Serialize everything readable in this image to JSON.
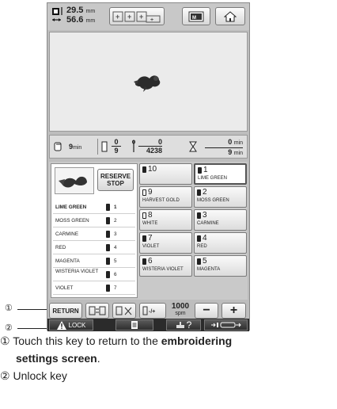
{
  "topbar": {
    "width": "29.5",
    "height": "56.6",
    "unit": "mm",
    "icons": [
      "size-icon",
      "move-pattern-icon",
      "memory-icon",
      "home-icon"
    ]
  },
  "status": {
    "remaining_time": "9",
    "remaining_time_unit": "min",
    "color_current": "0",
    "color_total": "9",
    "stitch_current": "0",
    "stitch_total": "4238",
    "time_elapsed": "0",
    "time_total": "9",
    "time_unit": "min"
  },
  "reserve_stop": "RESERVE STOP",
  "thread_list": [
    {
      "name": "LIME GREEN",
      "no": "1"
    },
    {
      "name": "MOSS GREEN",
      "no": "2"
    },
    {
      "name": "CARMINE",
      "no": "3"
    },
    {
      "name": "RED",
      "no": "4"
    },
    {
      "name": "MAGENTA",
      "no": "5"
    },
    {
      "name": "WISTERIA VIOLET",
      "no": "6"
    },
    {
      "name": "VIOLET",
      "no": "7"
    }
  ],
  "needles": [
    {
      "no": "10",
      "name": ""
    },
    {
      "no": "1",
      "name": "LIME GREEN"
    },
    {
      "no": "9",
      "name": "HARVEST GOLD"
    },
    {
      "no": "2",
      "name": "MOSS GREEN"
    },
    {
      "no": "8",
      "name": "WHITE"
    },
    {
      "no": "3",
      "name": "CARMINE"
    },
    {
      "no": "7",
      "name": "VIOLET"
    },
    {
      "no": "4",
      "name": "RED"
    },
    {
      "no": "6",
      "name": "WISTERIA VIOLET"
    },
    {
      "no": "5",
      "name": "MAGENTA"
    }
  ],
  "bottom": {
    "return_label": "RETURN",
    "speed": "1000",
    "speed_unit": "spm",
    "minus": "−",
    "plus": "+"
  },
  "lockbar": {
    "lock_label": "LOCK",
    "help": "?"
  },
  "callouts": {
    "one": "①",
    "two": "②"
  },
  "notes": {
    "note1_prefix": "Touch this key to return to the ",
    "note1_bold": "embroidering",
    "note1_bold2": "settings screen",
    "note1_end": ".",
    "note2": "Unlock key"
  },
  "colors": {
    "screen": "#bdbdbd",
    "lockbar": "#2b2b2b"
  }
}
